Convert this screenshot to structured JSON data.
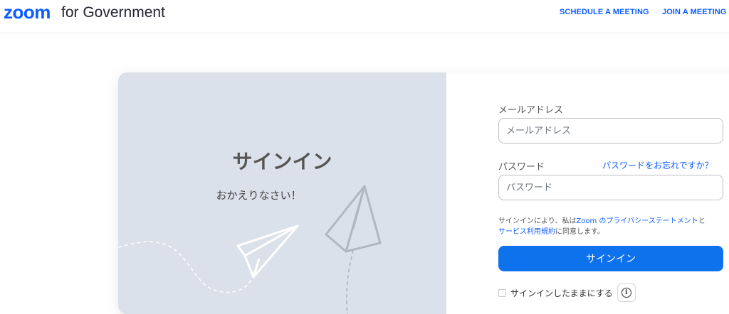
{
  "header": {
    "logo": "zoom",
    "logo_suffix": "for Government",
    "nav": {
      "schedule": "SCHEDULE A MEETING",
      "join": "JOIN A MEETING"
    }
  },
  "hero": {
    "title": "サインイン",
    "subtitle": "おかえりなさい！",
    "decoration_icons": [
      "paper-plane-icon",
      "paper-plane-icon"
    ]
  },
  "form": {
    "email_label": "メールアドレス",
    "email_placeholder": "メールアドレス",
    "email_value": "",
    "password_label": "パスワード",
    "password_placeholder": "パスワード",
    "password_value": "",
    "forgot_link": "パスワードをお忘れですか？",
    "terms_prefix": "サインインにより、私は",
    "terms_link_privacy": "Zoom のプライバシーステートメント",
    "terms_mid": "と",
    "terms_link_tos": "サービス利用規約",
    "terms_suffix": "に同意します。",
    "signin_button": "サインイン",
    "stay_signed_in": "サインインしたままにする",
    "stay_signed_in_checked": false,
    "info_icon": "info-icon"
  },
  "colors": {
    "brand": "#0b5cff",
    "button": "#0e72ed",
    "hero_bg": "#dbe1ea"
  }
}
